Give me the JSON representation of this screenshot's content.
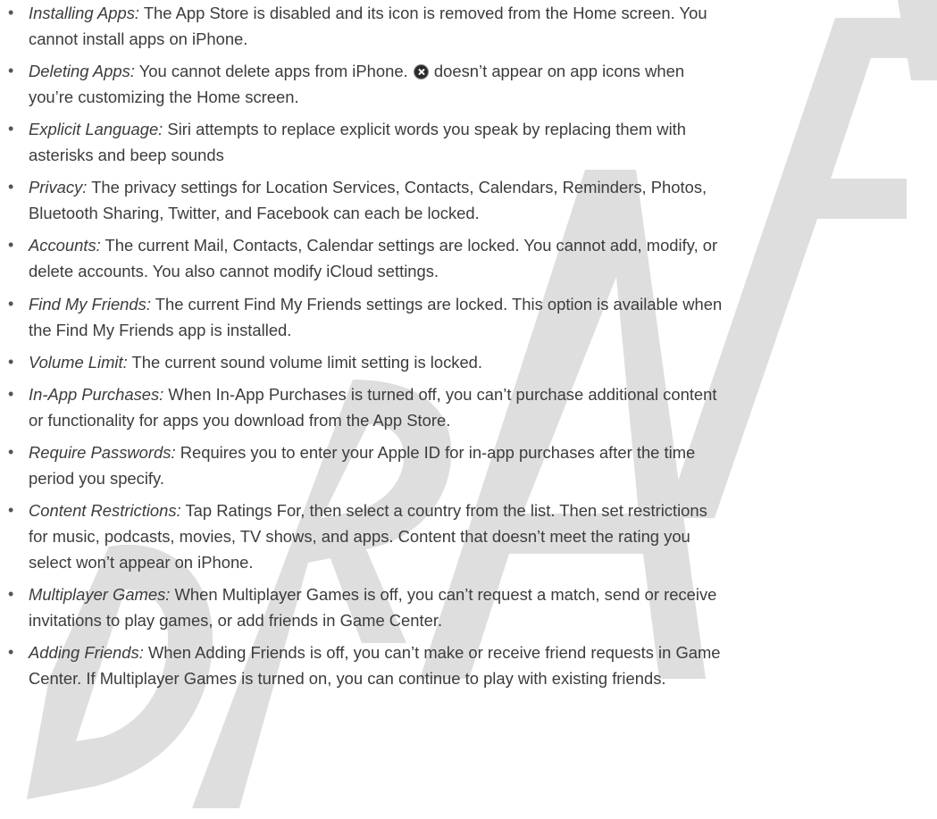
{
  "watermark": {
    "text": "DRAFT",
    "color": "#dedede"
  },
  "items": [
    {
      "term": "Installing Apps:",
      "lines": [
        "The App Store is disabled and its icon is removed from the Home screen. You",
        "cannot install apps on iPhone."
      ]
    },
    {
      "term": "Deleting Apps:",
      "line1_before_icon": "You cannot delete apps from iPhone.",
      "icon": "delete-badge-icon",
      "line1_after_icon": "doesn’t appear on app icons when",
      "line2": "you’re customizing the Home screen."
    },
    {
      "term": "Explicit Language:",
      "lines": [
        "Siri attempts to replace explicit words you speak by replacing them with",
        "asterisks and beep sounds"
      ]
    },
    {
      "term": "Privacy:",
      "lines": [
        "The privacy settings for Location Services, Contacts, Calendars, Reminders, Photos,",
        "Bluetooth Sharing, Twitter, and Facebook can each be locked."
      ]
    },
    {
      "term": "Accounts:",
      "lines": [
        "The current Mail, Contacts, Calendar settings are locked. You cannot add, modify, or",
        "delete accounts. You also cannot modify iCloud settings."
      ]
    },
    {
      "term": "Find My Friends:",
      "lines": [
        "The current Find My Friends settings are locked. This option is available when",
        "the Find My Friends app is installed."
      ]
    },
    {
      "term": "Volume Limit:",
      "lines": [
        "The current sound volume limit setting is locked."
      ]
    },
    {
      "term": "In-App Purchases:",
      "lines": [
        "When In-App Purchases is turned off, you can’t purchase additional content",
        "or functionality for apps you download from the App Store."
      ]
    },
    {
      "term": "Require Passwords:",
      "lines": [
        "Requires you to enter your Apple ID for in-app purchases after the time",
        "period you specify."
      ]
    },
    {
      "term": "Content Restrictions:",
      "lines": [
        "Tap Ratings For, then select a country from the list. Then set restrictions",
        "for music, podcasts, movies, TV shows, and apps. Content that doesn’t meet the rating you",
        "select won’t appear on iPhone."
      ]
    },
    {
      "term": "Multiplayer Games:",
      "lines": [
        "When Multiplayer Games is off, you can’t request a match, send or receive",
        "invitations to play games, or add friends in Game Center."
      ]
    },
    {
      "term": "Adding Friends:",
      "lines": [
        "When Adding Friends is off, you can’t make or receive friend requests in Game",
        "Center. If Multiplayer Games is turned on, you can continue to play with existing friends."
      ]
    }
  ]
}
